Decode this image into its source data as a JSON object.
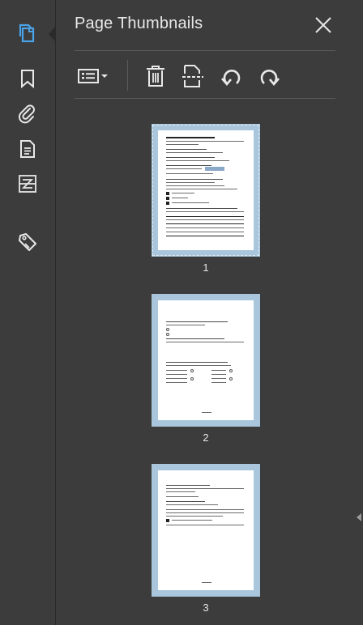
{
  "panel": {
    "title": "Page Thumbnails",
    "close_icon": "close-icon"
  },
  "rail": {
    "items": [
      {
        "name": "page-thumbnails",
        "icon": "copy-pages-icon",
        "active": true
      },
      {
        "name": "bookmarks",
        "icon": "bookmark-icon"
      },
      {
        "name": "attachments",
        "icon": "paperclip-icon"
      },
      {
        "name": "document",
        "icon": "document-icon"
      },
      {
        "name": "compare",
        "icon": "compare-icon"
      },
      {
        "name": "tags",
        "icon": "tag-icon"
      }
    ]
  },
  "toolbar": {
    "items": [
      {
        "name": "options-menu",
        "icon": "list-options-icon"
      },
      {
        "name": "delete",
        "icon": "trash-icon"
      },
      {
        "name": "split-page",
        "icon": "split-page-icon"
      },
      {
        "name": "rotate-left",
        "icon": "rotate-ccw-icon"
      },
      {
        "name": "rotate-right",
        "icon": "rotate-cw-icon"
      }
    ]
  },
  "thumbnails": [
    {
      "page": "1",
      "selected": true
    },
    {
      "page": "2",
      "selected": false
    },
    {
      "page": "3",
      "selected": false
    }
  ],
  "colors": {
    "accent": "#4aa3e8",
    "background": "#3c3c3c",
    "thumbnail_frame": "#a9c6dc"
  }
}
